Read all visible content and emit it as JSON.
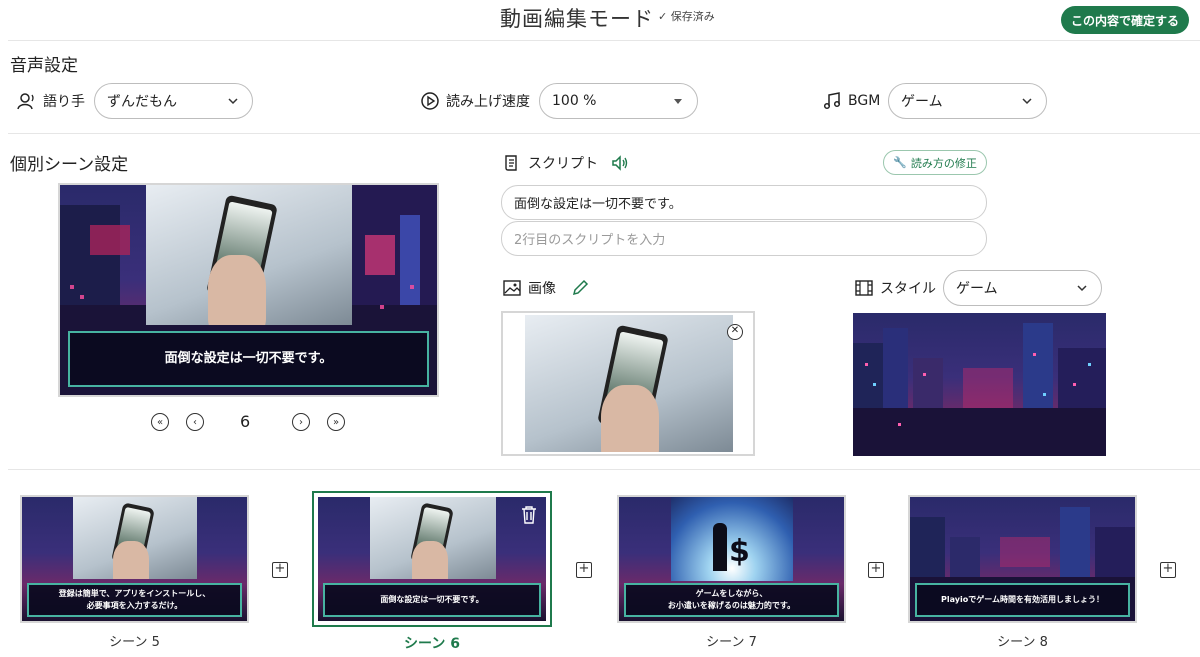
{
  "header": {
    "title": "動画編集モード",
    "saved_label": "保存済み",
    "confirm_button": "この内容で確定する"
  },
  "audio_settings": {
    "section_title": "音声設定",
    "narrator_label": "語り手",
    "narrator_value": "ずんだもん",
    "speed_label": "読み上げ速度",
    "speed_value": "100 %",
    "bgm_label": "BGM",
    "bgm_value": "ゲーム"
  },
  "scene_settings": {
    "section_title": "個別シーン設定",
    "preview_caption": "面倒な設定は一切不要です。",
    "current_page": "6",
    "script_label": "スクリプト",
    "fix_reading_button": "読み方の修正",
    "script_line1": "面倒な設定は一切不要です。",
    "script_line2_placeholder": "2行目のスクリプトを入力",
    "image_label": "画像",
    "style_label": "スタイル",
    "style_value": "ゲーム"
  },
  "scenes": [
    {
      "label": "シーン 5",
      "caption": "登録は簡単で、アプリをインストールし、\n必要事項を入力するだけ。",
      "active": false
    },
    {
      "label": "シーン 6",
      "caption": "面倒な設定は一切不要です。",
      "active": true
    },
    {
      "label": "シーン 7",
      "caption": "ゲームをしながら、\nお小遣いを稼げるのは魅力的です。",
      "active": false
    },
    {
      "label": "シーン 8",
      "caption": "Playioでゲーム時間を有効活用しましょう！",
      "active": false
    }
  ],
  "colors": {
    "accent": "#1f7a4c",
    "caption_border": "#47b3a1"
  }
}
